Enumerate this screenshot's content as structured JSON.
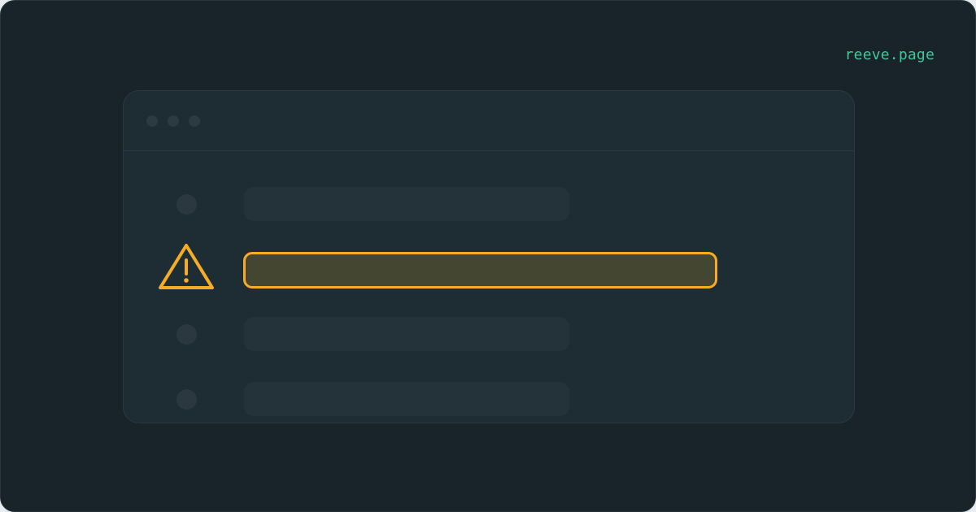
{
  "brand": {
    "text": "reeve.page",
    "color": "#3fc79a"
  },
  "window": {
    "controls": [
      "dot",
      "dot",
      "dot"
    ],
    "rows": [
      {
        "status": "normal"
      },
      {
        "status": "warning",
        "icon": "warning-triangle-icon",
        "highlight_color": "#f5ad25"
      },
      {
        "status": "normal"
      },
      {
        "status": "normal"
      }
    ]
  },
  "colors": {
    "background": "#19232a",
    "window": "#1e2c34",
    "placeholder": "#24323a",
    "warning": "#f5ad25"
  }
}
